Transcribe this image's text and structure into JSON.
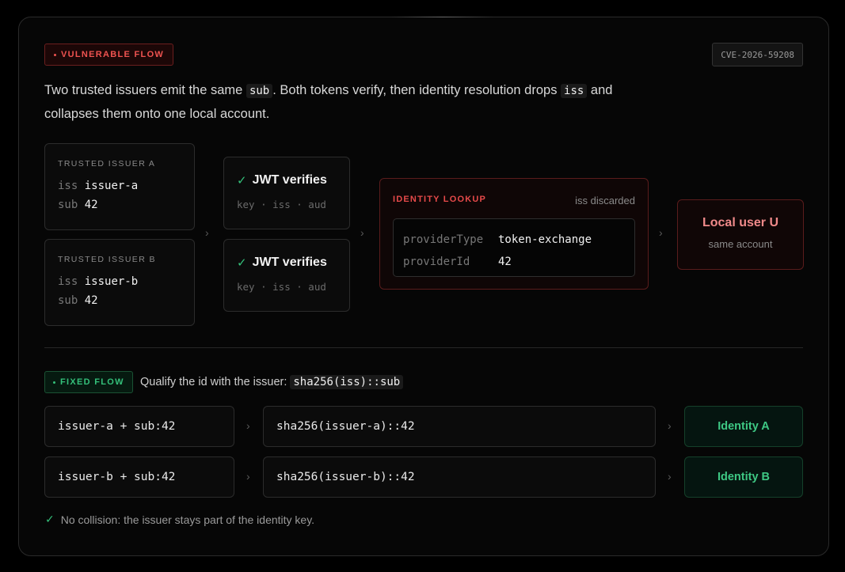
{
  "vulnerable": {
    "badge": "VULNERABLE FLOW",
    "cve": "CVE-2026-59208",
    "intro": {
      "p1": "Two trusted issuers emit the same ",
      "c1": "sub",
      "p2": ". Both tokens verify, then identity resolution drops ",
      "c2": "iss",
      "p3": " and collapses them onto one local account."
    },
    "issuers": [
      {
        "title": "TRUSTED ISSUER A",
        "iss_key": "iss",
        "iss_val": "issuer-a",
        "sub_key": "sub",
        "sub_val": "42"
      },
      {
        "title": "TRUSTED ISSUER B",
        "iss_key": "iss",
        "iss_val": "issuer-b",
        "sub_key": "sub",
        "sub_val": "42"
      }
    ],
    "verify": [
      {
        "label": "JWT verifies",
        "keys": "key · iss · aud"
      },
      {
        "label": "JWT verifies",
        "keys": "key · iss · aud"
      }
    ],
    "lookup": {
      "title": "IDENTITY LOOKUP",
      "discarded": "iss discarded",
      "rows": [
        {
          "key": "providerType",
          "value": "token-exchange"
        },
        {
          "key": "providerId",
          "value": "42"
        }
      ]
    },
    "local_user": {
      "title": "Local user U",
      "subtitle": "same account"
    }
  },
  "fixed": {
    "badge": "FIXED FLOW",
    "desc": "Qualify the id with the issuer:",
    "desc_code": "sha256(iss)::sub",
    "rows": [
      {
        "input": "issuer-a + sub:42",
        "hash": "sha256(issuer-a)::42",
        "identity": "Identity A"
      },
      {
        "input": "issuer-b + sub:42",
        "hash": "sha256(issuer-b)::42",
        "identity": "Identity B"
      }
    ],
    "note": "No collision: the issuer stays part of the identity key."
  },
  "glyphs": {
    "arrow": "›",
    "check": "✓"
  },
  "colors": {
    "danger": "#ef5350",
    "success": "#34c07a"
  }
}
